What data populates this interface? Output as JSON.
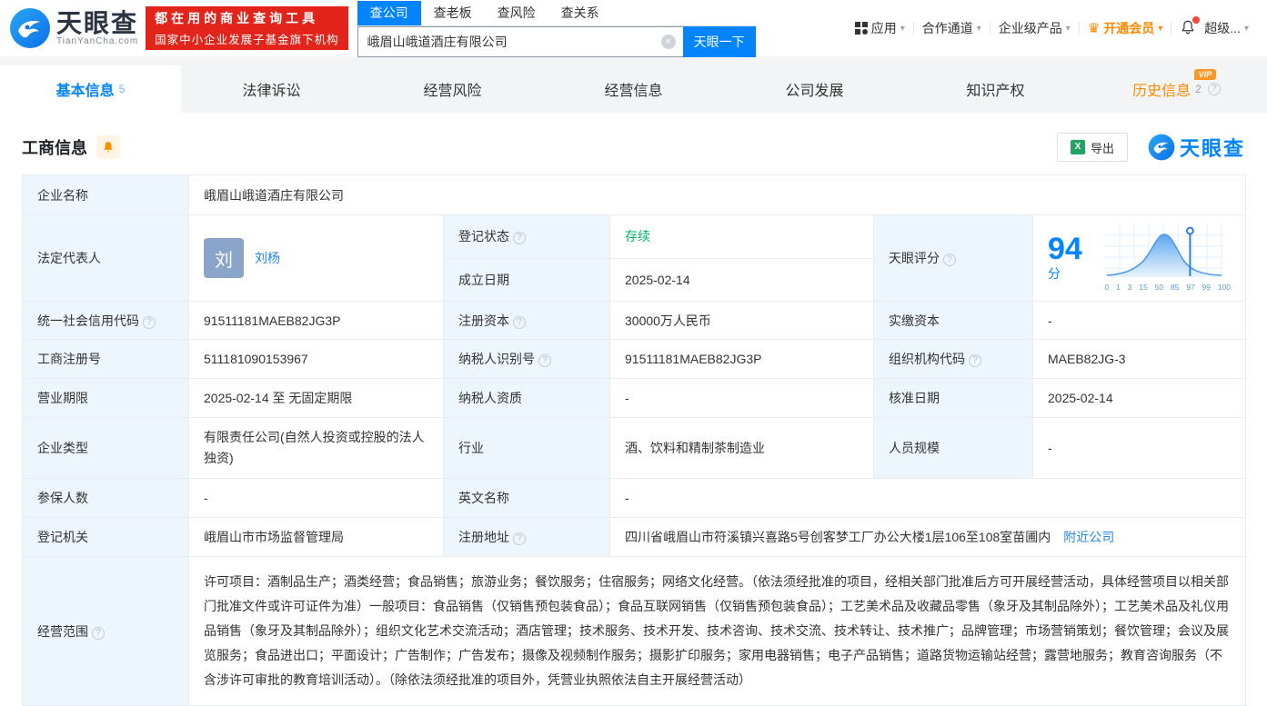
{
  "icons": {
    "help": "?",
    "caret": "▾",
    "clear": "×",
    "crown": "♛",
    "excel": "X"
  },
  "header": {
    "logo_title": "天眼查",
    "logo_subtitle": "TianYanCha.com",
    "promo_line1": "都在用的商业查询工具",
    "promo_line2": "国家中小企业发展子基金旗下机构",
    "search_tabs": [
      {
        "label": "查公司"
      },
      {
        "label": "查老板"
      },
      {
        "label": "查风险"
      },
      {
        "label": "查关系"
      }
    ],
    "search": {
      "value": "峨眉山峨道酒庄有限公司",
      "button": "天眼一下"
    },
    "nav": {
      "apps": "应用",
      "partner": "合作通道",
      "enterprise": "企业级产品",
      "vip": "开通会员",
      "more": "超级..."
    }
  },
  "tabs": [
    {
      "label": "基本信息",
      "count": "5"
    },
    {
      "label": "法律诉讼"
    },
    {
      "label": "经营风险"
    },
    {
      "label": "经营信息"
    },
    {
      "label": "公司发展"
    },
    {
      "label": "知识产权"
    },
    {
      "label": "历史信息",
      "count": "2",
      "vip_badge": "VIP"
    }
  ],
  "section": {
    "title": "工商信息",
    "export_label": "导出",
    "watermark": "天眼查"
  },
  "table": {
    "company_name_label": "企业名称",
    "company_name_value": "峨眉山峨道酒庄有限公司",
    "legal_rep_label": "法定代表人",
    "legal_rep_avatar": "刘",
    "legal_rep_name": "刘杨",
    "reg_status_label": "登记状态",
    "reg_status_value": "存续",
    "est_date_label": "成立日期",
    "est_date_value": "2025-02-14",
    "score_label": "天眼评分",
    "uscc_label": "统一社会信用代码",
    "uscc_value": "91511181MAEB82JG3P",
    "reg_capital_label": "注册资本",
    "reg_capital_value": "30000万人民币",
    "paid_capital_label": "实缴资本",
    "paid_capital_value": "-",
    "reg_number_label": "工商注册号",
    "reg_number_value": "511181090153967",
    "taxpayer_id_label": "纳税人识别号",
    "taxpayer_id_value": "91511181MAEB82JG3P",
    "org_code_label": "组织机构代码",
    "org_code_value": "MAEB82JG-3",
    "term_label": "营业期限",
    "term_value": "2025-02-14 至 无固定期限",
    "taxpayer_qual_label": "纳税人资质",
    "taxpayer_qual_value": "-",
    "approval_date_label": "核准日期",
    "approval_date_value": "2025-02-14",
    "company_type_label": "企业类型",
    "company_type_value": "有限责任公司(自然人投资或控股的法人独资)",
    "industry_label": "行业",
    "industry_value": "酒、饮料和精制茶制造业",
    "staff_size_label": "人员规模",
    "staff_size_value": "-",
    "insured_label": "参保人数",
    "insured_value": "-",
    "english_name_label": "英文名称",
    "english_name_value": "-",
    "reg_authority_label": "登记机关",
    "reg_authority_value": "峨眉山市市场监督管理局",
    "address_label": "注册地址",
    "address_value": "四川省峨眉山市符溪镇兴喜路5号创客梦工厂办公大楼1层106至108室苗圃内",
    "nearby_link": "附近公司",
    "scope_label": "经营范围",
    "scope_value": "许可项目：酒制品生产；酒类经营；食品销售；旅游业务；餐饮服务；住宿服务；网络文化经营。（依法须经批准的项目，经相关部门批准后方可开展经营活动，具体经营项目以相关部门批准文件或许可证件为准）一般项目：食品销售（仅销售预包装食品）；食品互联网销售（仅销售预包装食品）；工艺美术品及收藏品零售（象牙及其制品除外）；工艺美术品及礼仪用品销售（象牙及其制品除外）；组织文化艺术交流活动；酒店管理；技术服务、技术开发、技术咨询、技术交流、技术转让、技术推广；品牌管理；市场营销策划；餐饮管理；会议及展览服务；食品进出口；平面设计；广告制作；广告发布；摄像及视频制作服务；摄影扩印服务；家用电器销售；电子产品销售；道路货物运输站经营；露营地服务；教育咨询服务（不含涉许可审批的教育培训活动）。（除依法须经批准的项目外，凭营业执照依法自主开展经营活动）"
  },
  "score_chart": {
    "type": "area",
    "score": "94",
    "unit": "分",
    "ticks": [
      "0",
      "1",
      "3",
      "15",
      "50",
      "85",
      "97",
      "99",
      "100"
    ]
  }
}
